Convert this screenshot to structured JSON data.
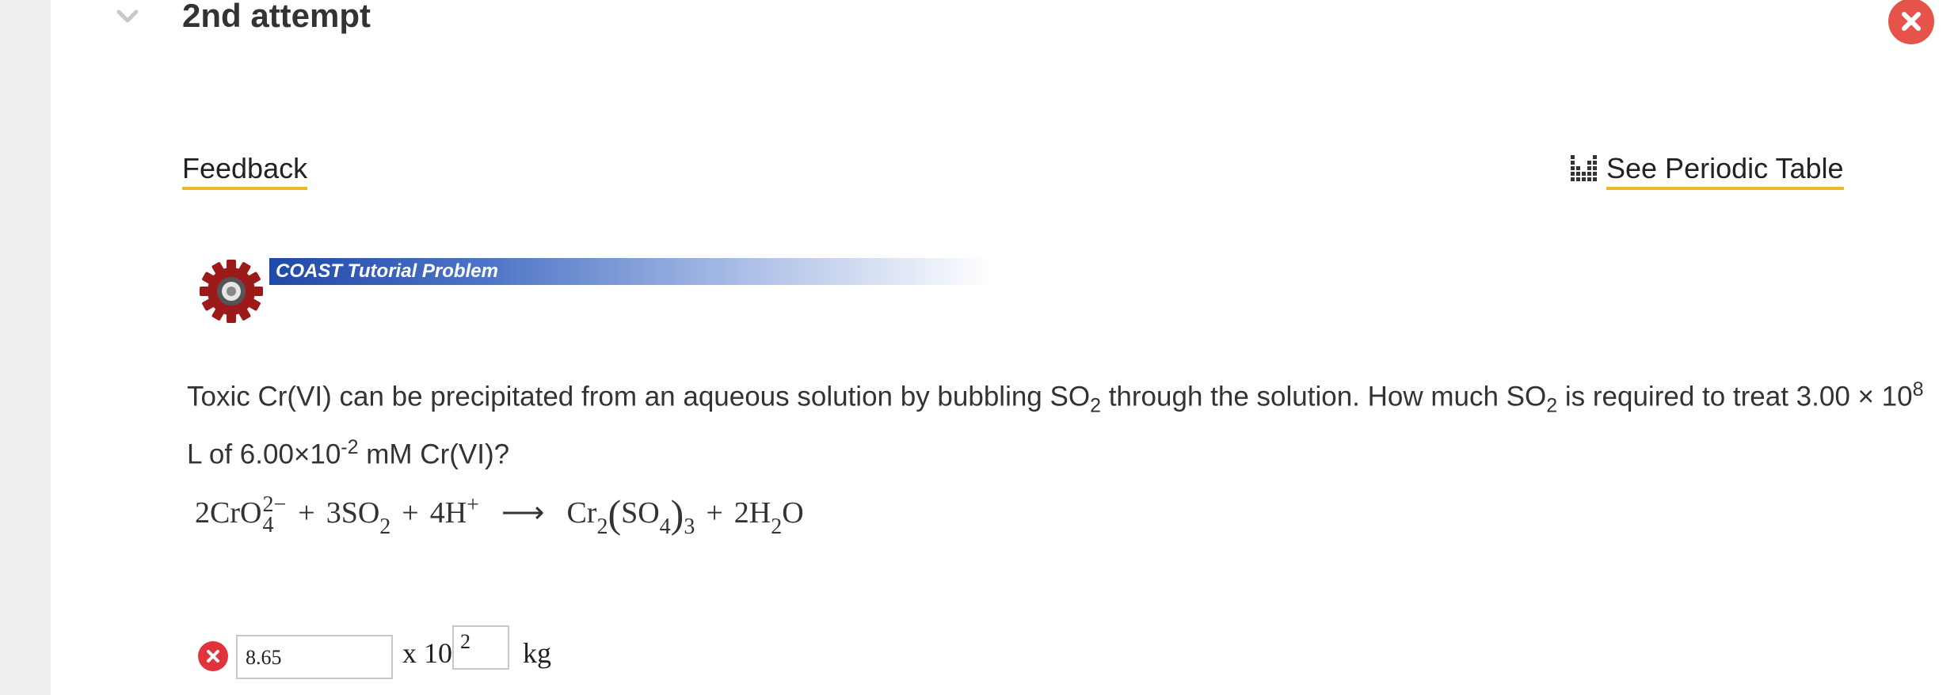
{
  "header": {
    "attempt_title": "2nd attempt"
  },
  "links": {
    "feedback": "Feedback",
    "periodic_table": "See Periodic Table"
  },
  "banner": {
    "label": "COAST Tutorial Problem"
  },
  "question": {
    "p1": "Toxic Cr(VI) can be precipitated from an aqueous solution by bubbling SO",
    "sub_a": "2",
    "p2": " through the solution. How much SO",
    "sub_b": "2",
    "p3": " is required to treat 3.00 × 10",
    "sup_a": "8",
    "p4": " L of 6.00×10",
    "sup_b": "-2",
    "p5": " mM Cr(VI)?"
  },
  "reaction": {
    "r1": "2CrO",
    "r1_charge": "2−",
    "r1_sub": "4",
    "plus1": "+",
    "r2": "3SO",
    "r2_sub": "2",
    "plus2": "+",
    "r3": "4H",
    "r3_charge": "+",
    "arrow": "⟶",
    "p1": "Cr",
    "p1_sub": "2",
    "lparen": "(",
    "p1_inner": "SO",
    "p1_inner_sub": "4",
    "rparen": ")",
    "p1_outer_sub": "3",
    "plus3": "+",
    "p2": "2H",
    "p2_sub": "2",
    "p2_end": "O"
  },
  "answer": {
    "mantissa_value": "8.65",
    "times_label": "x 10",
    "exponent_value": "2",
    "unit": "kg",
    "status": "incorrect"
  },
  "colors": {
    "accent_underline": "#e8b92a",
    "error_red": "#e0333c",
    "banner_blue": "#1f49a8"
  },
  "icons": [
    "chevron-down-icon",
    "close-icon",
    "periodic-table-icon",
    "gear-logo-icon",
    "incorrect-icon"
  ]
}
